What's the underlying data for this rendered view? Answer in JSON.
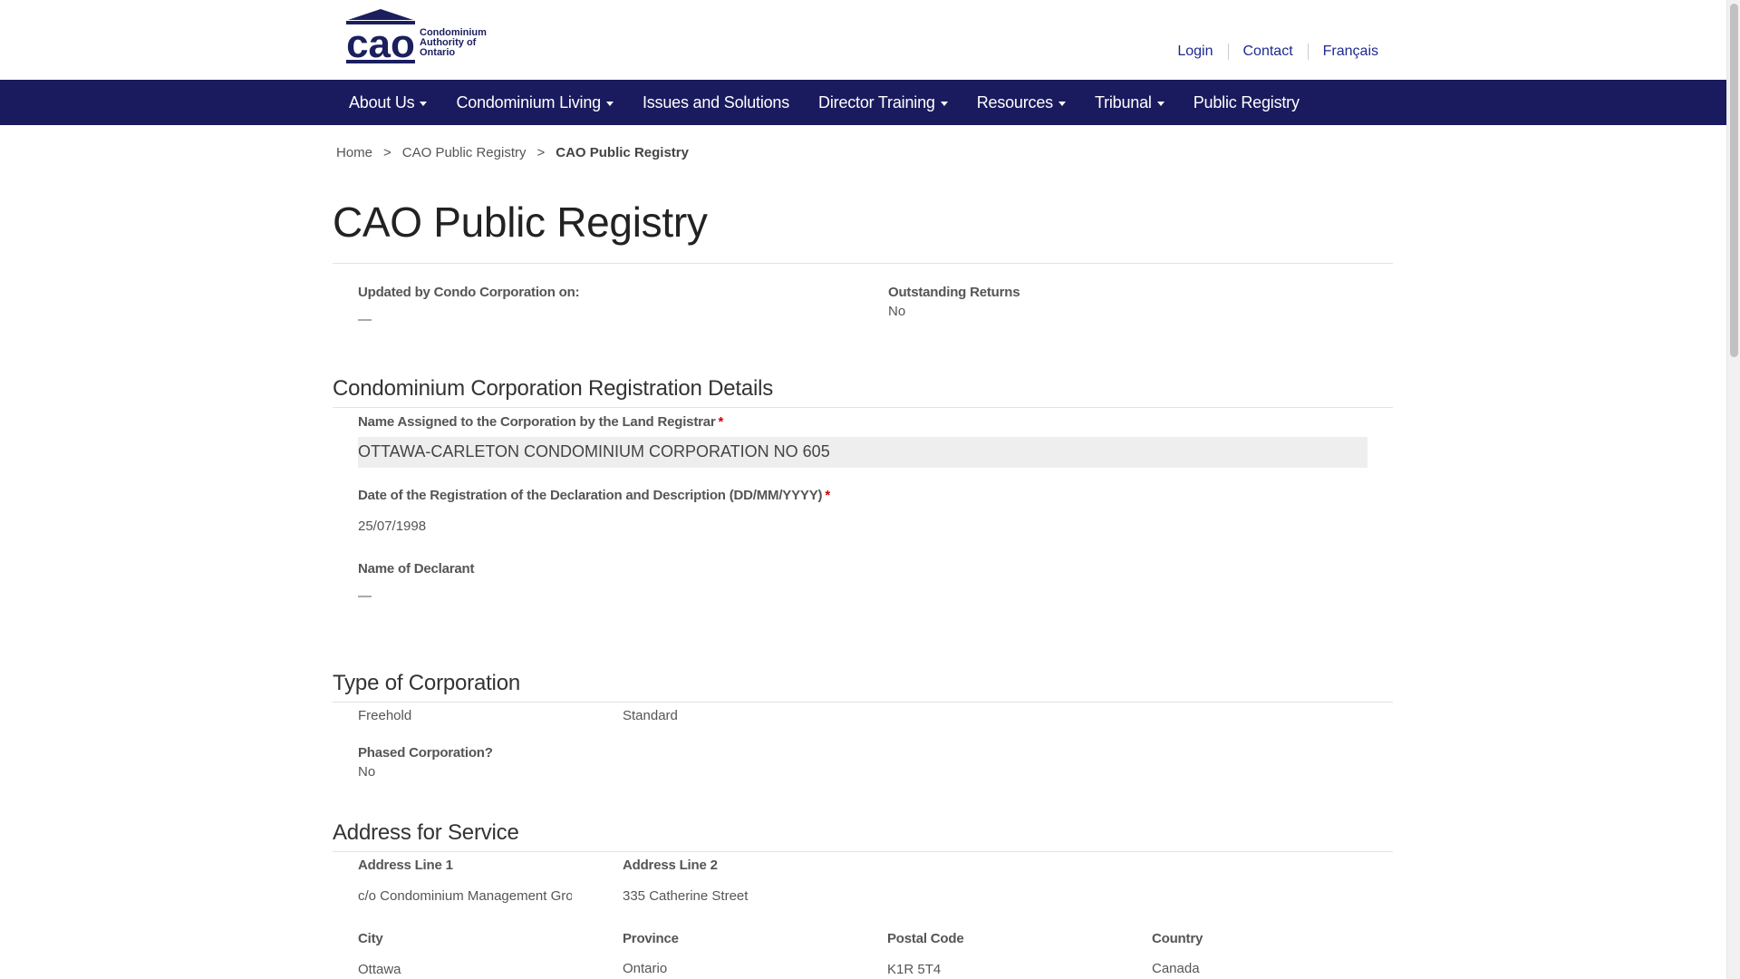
{
  "header": {
    "logo_text": "cao",
    "logo_subtitle": [
      "Condominium",
      "Authority of",
      "Ontario"
    ],
    "links": [
      "Login",
      "Contact",
      "Français"
    ]
  },
  "nav": {
    "items": [
      {
        "label": "About Us",
        "dropdown": true
      },
      {
        "label": "Condominium Living",
        "dropdown": true
      },
      {
        "label": "Issues and Solutions",
        "dropdown": false
      },
      {
        "label": "Director Training",
        "dropdown": true
      },
      {
        "label": "Resources",
        "dropdown": true
      },
      {
        "label": "Tribunal",
        "dropdown": true
      },
      {
        "label": "Public Registry",
        "dropdown": false
      }
    ]
  },
  "breadcrumb": {
    "items": [
      "Home",
      "CAO Public Registry",
      "CAO Public Registry"
    ],
    "separator": ">"
  },
  "page_title": "CAO Public Registry",
  "summary": {
    "updated_label": "Updated by Condo Corporation on:",
    "updated_value": "—",
    "outstanding_label": "Outstanding Returns",
    "outstanding_value": "No"
  },
  "registration": {
    "title": "Condominium Corporation Registration Details",
    "name_label": "Name Assigned to the Corporation by the Land Registrar",
    "name_value": "OTTAWA-CARLETON CONDOMINIUM CORPORATION NO 605",
    "date_label": "Date of the Registration of the Declaration and Description (DD/MM/YYYY)",
    "date_value": "25/07/1998",
    "declarant_label": "Name of Declarant",
    "declarant_value": "—",
    "required_marker": "*"
  },
  "type": {
    "title": "Type of Corporation",
    "tenure": "Freehold",
    "kind": "Standard",
    "phased_label": "Phased Corporation?",
    "phased_value": "No"
  },
  "address": {
    "title": "Address for Service",
    "line1_label": "Address Line 1",
    "line1_value": "c/o Condominium Management Group",
    "line2_label": "Address Line 2",
    "line2_value": "335 Catherine Street",
    "city_label": "City",
    "city_value": "Ottawa",
    "province_label": "Province",
    "province_value": "Ontario",
    "postal_label": "Postal Code",
    "postal_value": "K1R 5T4",
    "country_label": "Country",
    "country_value": "Canada"
  },
  "colors": {
    "nav_bg": "#1a1a5e",
    "link": "#1d2a8f",
    "required": "#cc0000"
  }
}
